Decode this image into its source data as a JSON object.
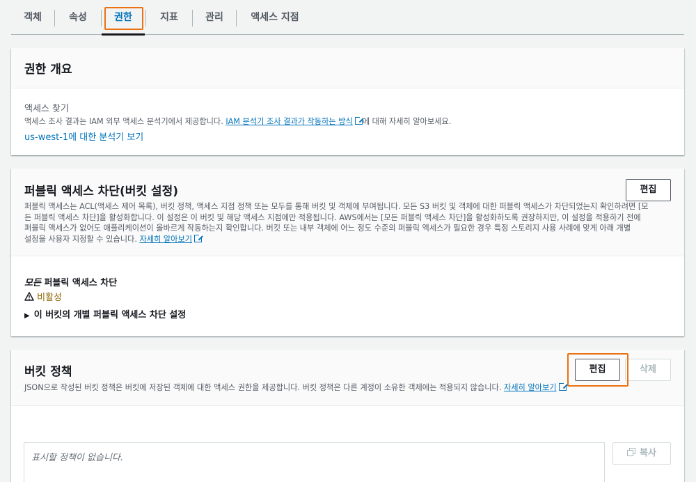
{
  "tabs": [
    {
      "label": "객체"
    },
    {
      "label": "속성"
    },
    {
      "label": "권한"
    },
    {
      "label": "지표"
    },
    {
      "label": "관리"
    },
    {
      "label": "액세스 지점"
    }
  ],
  "overview": {
    "title": "권한 개요",
    "subtitle": "액세스 찾기",
    "desc_prefix": "액세스 조사 결과는 IAM 외부 액세스 분석기에서 제공합니다. ",
    "desc_link": "IAM 분석기 조사 결과가 작동하는 방식",
    "desc_suffix": "에 대해 자세히 알아보세요.",
    "region_link": "us-west-1에 대한 분석기 보기"
  },
  "block_public": {
    "title": "퍼블릭 액세스 차단(버킷 설정)",
    "edit_label": "편집",
    "desc_lines": [
      "퍼블릭 액세스는 ACL(액세스 제어 목록), 버킷 정책, 액세스 지점 정책 또는 모두를 통해 버킷 및 객체에 부여됩니다. 모든 S3 버킷 및 객체에 대한 퍼블릭 액세스가 차단되었는지 확인하려면 [모",
      "든 퍼블릭 액세스 차단]을 활성화합니다. 이 설정은 이 버킷 및 해당 액세스 지점에만 적용됩니다. AWS에서는 [모든 퍼블릭 액세스 차단]을 활성화하도록 권장하지만, 이 설정을 적용하기 전에",
      "퍼블릭 액세스가 없어도 애플리케이션이 올바르게 작동하는지 확인합니다. 버킷 또는 내부 객체에 어느 정도 수준의 퍼블릭 액세스가 필요한 경우 특정 스토리지 사용 사례에 맞게 아래 개별",
      "설정을 사용자 지정할 수 있습니다. "
    ],
    "learn_more": "자세히 알아보기",
    "all_block_italic": "모든",
    "all_block_rest": " 퍼블릭 액세스 차단",
    "status": "비활성",
    "expand_label": "이 버킷의 개별 퍼블릭 액세스 차단 설정"
  },
  "bucket_policy": {
    "title": "버킷 정책",
    "edit_label": "편집",
    "delete_label": "삭제",
    "desc": "JSON으로 작성된 버킷 정책은 버킷에 저장된 객체에 대한 액세스 권한을 제공합니다. 버킷 정책은 다른 계정이 소유한 객체에는 적용되지 않습니다. ",
    "learn_more": "자세히 알아보기",
    "empty_text": "표시할 정책이 없습니다.",
    "copy_label": "복사"
  },
  "colors": {
    "accent": "#0073bb",
    "highlight": "#ec7211",
    "warning": "#8d6605"
  }
}
